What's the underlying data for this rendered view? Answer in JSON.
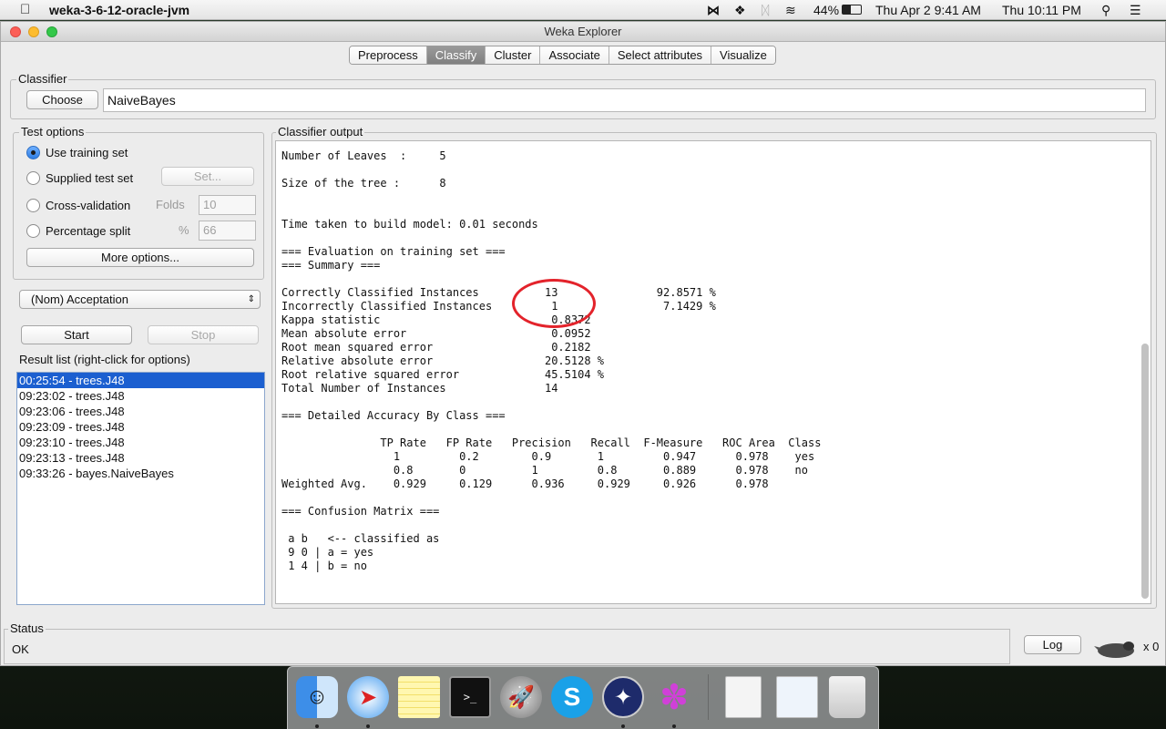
{
  "menubar": {
    "app_name": "weka-3-6-12-oracle-jvm",
    "battery": "44%",
    "date1": "Thu Apr 2  9:41 AM",
    "date2": "Thu 10:11 PM"
  },
  "window": {
    "title": "Weka Explorer"
  },
  "tabs": [
    "Preprocess",
    "Classify",
    "Cluster",
    "Associate",
    "Select attributes",
    "Visualize"
  ],
  "classifier": {
    "group_label": "Classifier",
    "choose_label": "Choose",
    "name": "NaiveBayes"
  },
  "test_options": {
    "group_label": "Test options",
    "use_training": "Use training set",
    "supplied": "Supplied test set",
    "set_button": "Set...",
    "cross_validation": "Cross-validation",
    "folds_label": "Folds",
    "folds_value": "10",
    "percentage_split": "Percentage split",
    "percent_label": "%",
    "percent_value": "66",
    "more_options": "More options..."
  },
  "class_select": "(Nom) Acceptation",
  "start_label": "Start",
  "stop_label": "Stop",
  "result_list": {
    "group_label": "Result list (right-click for options)",
    "items": [
      "00:25:54 - trees.J48",
      "09:23:02 - trees.J48",
      "09:23:06 - trees.J48",
      "09:23:09 - trees.J48",
      "09:23:10 - trees.J48",
      "09:23:13 - trees.J48",
      "09:33:26 - bayes.NaiveBayes"
    ]
  },
  "output": {
    "group_label": "Classifier output",
    "text": "Number of Leaves  :     5\n\nSize of the tree :      8\n\n\nTime taken to build model: 0.01 seconds\n\n=== Evaluation on training set ===\n=== Summary ===\n\nCorrectly Classified Instances          13               92.8571 %\nIncorrectly Classified Instances         1                7.1429 %\nKappa statistic                          0.8372\nMean absolute error                      0.0952\nRoot mean squared error                  0.2182\nRelative absolute error                 20.5128 %\nRoot relative squared error             45.5104 %\nTotal Number of Instances               14     \n\n=== Detailed Accuracy By Class ===\n\n               TP Rate   FP Rate   Precision   Recall  F-Measure   ROC Area  Class\n                 1         0.2        0.9       1         0.947      0.978    yes\n                 0.8       0          1         0.8       0.889      0.978    no\nWeighted Avg.    0.929     0.129      0.936     0.929     0.926      0.978\n\n=== Confusion Matrix ===\n\n a b   <-- classified as\n 9 0 | a = yes\n 1 4 | b = no"
  },
  "status": {
    "group_label": "Status",
    "text": "OK",
    "log_label": "Log",
    "count": "x 0"
  },
  "colors": {
    "highlight": "#e3232b",
    "selection": "#1b5fd0"
  }
}
